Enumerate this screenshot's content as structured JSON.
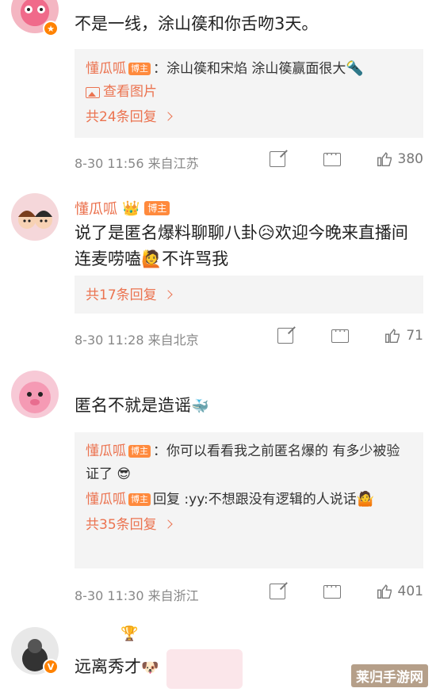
{
  "comments": [
    {
      "name": "",
      "text": "不是一线，涂山篌和你舌吻3天。",
      "reply_box": {
        "lines": [
          {
            "name": "懂瓜呱",
            "tag": "博主",
            "text": "：涂山篌和宋焰 涂山篌赢面很大"
          }
        ],
        "view_image": "查看图片",
        "more": "共24条回复"
      },
      "time": "8-30 11:56",
      "from": "来自江苏",
      "likes": "380"
    },
    {
      "name": "懂瓜呱",
      "tag": "博主",
      "text": "说了是匿名爆料聊聊八卦😥欢迎今晚来直播间连麦唠嗑🙋不许骂我",
      "reply_box": {
        "more": "共17条回复"
      },
      "time": "8-30 11:28",
      "from": "来自北京",
      "likes": "71"
    },
    {
      "name": "",
      "text": "匿名不就是造谣",
      "reply_box": {
        "lines": [
          {
            "name": "懂瓜呱",
            "tag": "博主",
            "text": "：你可以看看我之前匿名爆的 有多少被验证了 😎"
          },
          {
            "name": "懂瓜呱",
            "tag": "博主",
            "text": "回复 :yy:不想跟没有逻辑的人说话"
          }
        ],
        "more": "共35条回复"
      },
      "time": "8-30 11:30",
      "from": "来自浙江",
      "likes": "401"
    },
    {
      "name": "",
      "text": "远离秀才"
    }
  ],
  "watermark": "莱归手游网",
  "colors": {
    "accent": "#eb7350",
    "tag": "#ff8a3d",
    "verified": "#ff8200"
  }
}
